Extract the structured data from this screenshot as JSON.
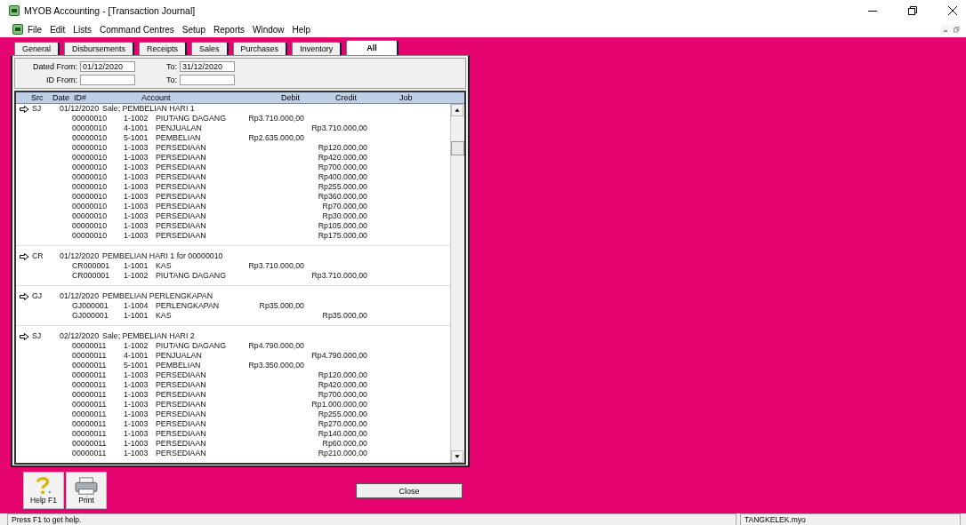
{
  "window": {
    "title": "MYOB Accounting - [Transaction Journal]"
  },
  "menu": [
    "File",
    "Edit",
    "Lists",
    "Command Centres",
    "Setup",
    "Reports",
    "Window",
    "Help"
  ],
  "tabs": [
    {
      "label": "General",
      "selected": false
    },
    {
      "label": "Disbursements",
      "selected": false
    },
    {
      "label": "Receipts",
      "selected": false
    },
    {
      "label": "Sales",
      "selected": false
    },
    {
      "label": "Purchases",
      "selected": false
    },
    {
      "label": "Inventory",
      "selected": false
    },
    {
      "label": "All",
      "selected": true
    }
  ],
  "filters": [
    {
      "label": "Dated From:",
      "value": "01/12/2020",
      "to_label": "To:",
      "to_value": "31/12/2020"
    },
    {
      "label": "ID From:",
      "to_label": "To:"
    }
  ],
  "table": {
    "columns": [
      "Src",
      "Date",
      "ID#",
      "Account",
      "Debit",
      "Credit",
      "Job"
    ],
    "groups": [
      {
        "src": "SJ",
        "date": "01/12/2020",
        "memo": "Sale; PEMBELIAN HARI 1",
        "lines": [
          {
            "id": "00000010",
            "account_no": "1-1002",
            "account": "PIUTANG DAGANG",
            "debit": "Rp3.710.000,00"
          },
          {
            "id": "00000010",
            "account_no": "4-1001",
            "account": "PENJUALAN",
            "credit": "Rp3.710.000,00"
          },
          {
            "id": "00000010",
            "account_no": "5-1001",
            "account": "PEMBELIAN",
            "debit": "Rp2.635.000,00"
          },
          {
            "id": "00000010",
            "account_no": "1-1003",
            "account": "PERSEDIAAN",
            "credit": "Rp120.000,00"
          },
          {
            "id": "00000010",
            "account_no": "1-1003",
            "account": "PERSEDIAAN",
            "credit": "Rp420.000,00"
          },
          {
            "id": "00000010",
            "account_no": "1-1003",
            "account": "PERSEDIAAN",
            "credit": "Rp700.000,00"
          },
          {
            "id": "00000010",
            "account_no": "1-1003",
            "account": "PERSEDIAAN",
            "credit": "Rp400.000,00"
          },
          {
            "id": "00000010",
            "account_no": "1-1003",
            "account": "PERSEDIAAN",
            "credit": "Rp255.000,00"
          },
          {
            "id": "00000010",
            "account_no": "1-1003",
            "account": "PERSEDIAAN",
            "credit": "Rp360.000,00"
          },
          {
            "id": "00000010",
            "account_no": "1-1003",
            "account": "PERSEDIAAN",
            "credit": "Rp70.000,00"
          },
          {
            "id": "00000010",
            "account_no": "1-1003",
            "account": "PERSEDIAAN",
            "credit": "Rp30.000,00"
          },
          {
            "id": "00000010",
            "account_no": "1-1003",
            "account": "PERSEDIAAN",
            "credit": "Rp105.000,00"
          },
          {
            "id": "00000010",
            "account_no": "1-1003",
            "account": "PERSEDIAAN",
            "credit": "Rp175.000,00"
          }
        ]
      },
      {
        "src": "CR",
        "date": "01/12/2020",
        "memo": "PEMBELIAN HARI 1 for 00000010",
        "lines": [
          {
            "id": "CR000001",
            "account_no": "1-1001",
            "account": "KAS",
            "debit": "Rp3.710.000,00"
          },
          {
            "id": "CR000001",
            "account_no": "1-1002",
            "account": "PIUTANG DAGANG",
            "credit": "Rp3.710.000,00"
          }
        ]
      },
      {
        "src": "GJ",
        "date": "01/12/2020",
        "memo": "PEMBELIAN PERLENGKAPAN",
        "lines": [
          {
            "id": "GJ000001",
            "account_no": "1-1004",
            "account": "PERLENGKAPAN",
            "debit": "Rp35.000,00"
          },
          {
            "id": "GJ000001",
            "account_no": "1-1001",
            "account": "KAS",
            "credit": "Rp35.000,00"
          }
        ]
      },
      {
        "src": "SJ",
        "date": "02/12/2020",
        "memo": "Sale; PEMBELIAN HARI 2",
        "lines": [
          {
            "id": "00000011",
            "account_no": "1-1002",
            "account": "PIUTANG DAGANG",
            "debit": "Rp4.790.000,00"
          },
          {
            "id": "00000011",
            "account_no": "4-1001",
            "account": "PENJUALAN",
            "credit": "Rp4.790.000,00"
          },
          {
            "id": "00000011",
            "account_no": "5-1001",
            "account": "PEMBELIAN",
            "debit": "Rp3.350.000,00"
          },
          {
            "id": "00000011",
            "account_no": "1-1003",
            "account": "PERSEDIAAN",
            "credit": "Rp120.000,00"
          },
          {
            "id": "00000011",
            "account_no": "1-1003",
            "account": "PERSEDIAAN",
            "credit": "Rp420.000,00"
          },
          {
            "id": "00000011",
            "account_no": "1-1003",
            "account": "PERSEDIAAN",
            "credit": "Rp700.000,00"
          },
          {
            "id": "00000011",
            "account_no": "1-1003",
            "account": "PERSEDIAAN",
            "credit": "Rp1.000.000,00"
          },
          {
            "id": "00000011",
            "account_no": "1-1003",
            "account": "PERSEDIAAN",
            "credit": "Rp255.000,00"
          },
          {
            "id": "00000011",
            "account_no": "1-1003",
            "account": "PERSEDIAAN",
            "credit": "Rp270.000,00"
          },
          {
            "id": "00000011",
            "account_no": "1-1003",
            "account": "PERSEDIAAN",
            "credit": "Rp140.000,00"
          },
          {
            "id": "00000011",
            "account_no": "1-1003",
            "account": "PERSEDIAAN",
            "credit": "Rp60.000,00"
          },
          {
            "id": "00000011",
            "account_no": "1-1003",
            "account": "PERSEDIAAN",
            "credit": "Rp210.000,00"
          }
        ]
      }
    ]
  },
  "toolbar": [
    {
      "kind": "help",
      "label": "Help F1"
    },
    {
      "kind": "print",
      "label": "Print"
    }
  ],
  "close_button": "Close",
  "status_bar": {
    "message": "Press F1 to get help.",
    "file": "TANGKELEK.myo"
  }
}
